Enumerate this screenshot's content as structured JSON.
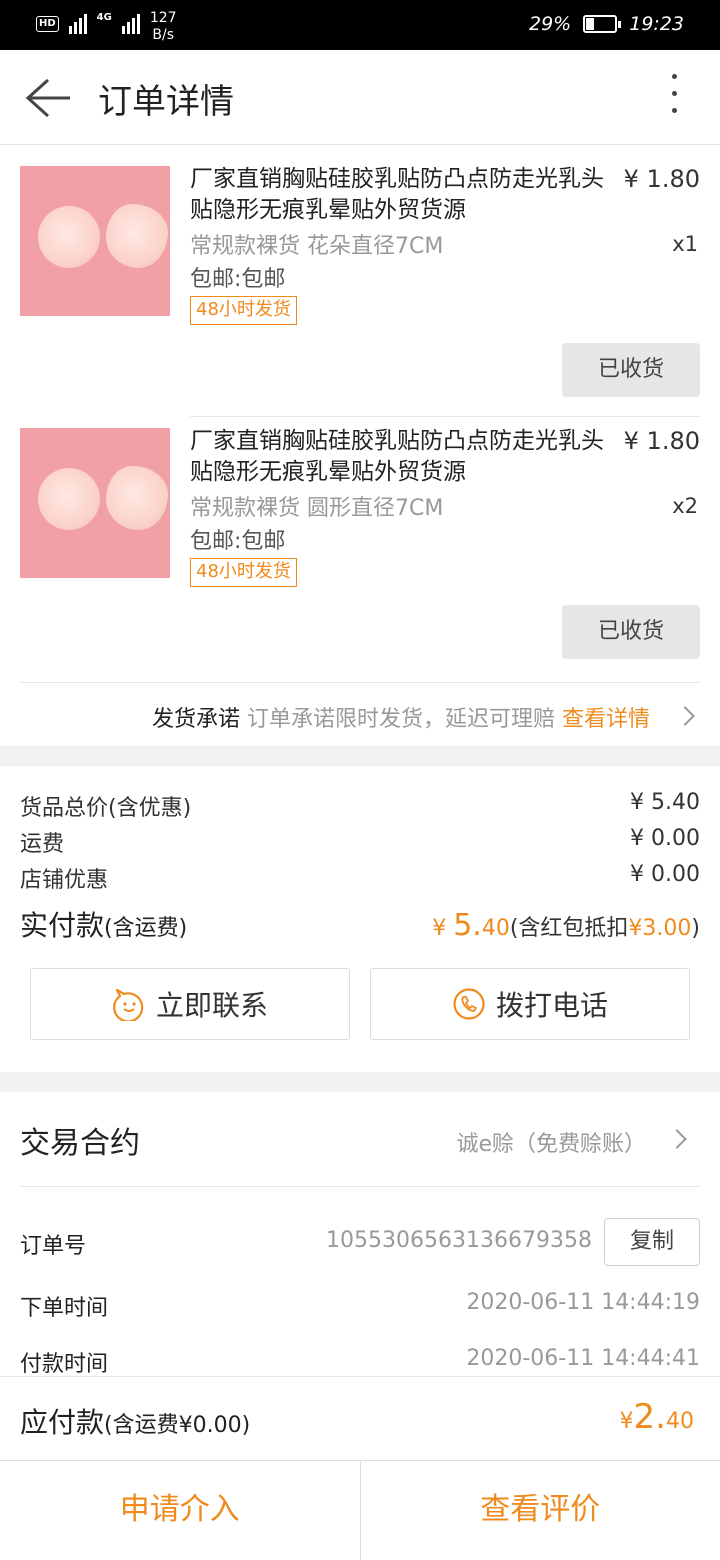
{
  "status_bar": {
    "hd_label": "HD",
    "network": "4G",
    "speed_value": "127",
    "speed_unit": "B/s",
    "battery_percent": "29%",
    "battery_level": 0.29,
    "time": "19:23"
  },
  "header": {
    "title": "订单详情"
  },
  "items": [
    {
      "title": "厂家直销胸贴硅胶乳贴防凸点防走光乳头贴隐形无痕乳晕贴外贸货源",
      "price": "¥ 1.80",
      "spec": "常规款裸货 花朵直径7CM",
      "qty": "x1",
      "shipping": "包邮:包邮",
      "tag": "48小时发货",
      "status_button": "已收货"
    },
    {
      "title": "厂家直销胸贴硅胶乳贴防凸点防走光乳头贴隐形无痕乳晕贴外贸货源",
      "price": "¥ 1.80",
      "spec": "常规款裸货 圆形直径7CM",
      "qty": "x2",
      "shipping": "包邮:包邮",
      "tag": "48小时发货",
      "status_button": "已收货"
    }
  ],
  "promise": {
    "label": "发货承诺",
    "text": "订单承诺限时发货，延迟可理赔",
    "link": "查看详情"
  },
  "summary": {
    "goods_total_label": "货品总价(含优惠)",
    "goods_total": "¥ 5.40",
    "freight_label": "运费",
    "freight": "¥ 0.00",
    "shop_discount_label": "店铺优惠",
    "shop_discount": "¥ 0.00",
    "paid_label": "实付款",
    "paid_note": "(含运费)",
    "paid_currency": "¥ ",
    "paid_int": "5.",
    "paid_dec": "40",
    "paid_extra_prefix": "(含红包抵扣",
    "paid_extra_amount": "¥3.00",
    "paid_extra_suffix": ")"
  },
  "actions": {
    "contact": "立即联系",
    "call": "拨打电话"
  },
  "contract": {
    "title": "交易合约",
    "value": "诚e赊（免费赊账）"
  },
  "order_info": {
    "order_no_label": "订单号",
    "order_no": "1055306563136679358",
    "copy_button": "复制",
    "order_time_label": "下单时间",
    "order_time": "2020-06-11 14:44:19",
    "pay_time_label": "付款时间",
    "pay_time": "2020-06-11 14:44:41"
  },
  "due": {
    "label": "应付款",
    "note": "(含运费¥0.00)",
    "currency": "¥",
    "int": "2.",
    "dec": "40"
  },
  "bottom_bar": {
    "apply": "申请介入",
    "review": "查看评价"
  },
  "colors": {
    "accent": "#f08a1c",
    "thumb_bg": "#f2a0a8"
  }
}
